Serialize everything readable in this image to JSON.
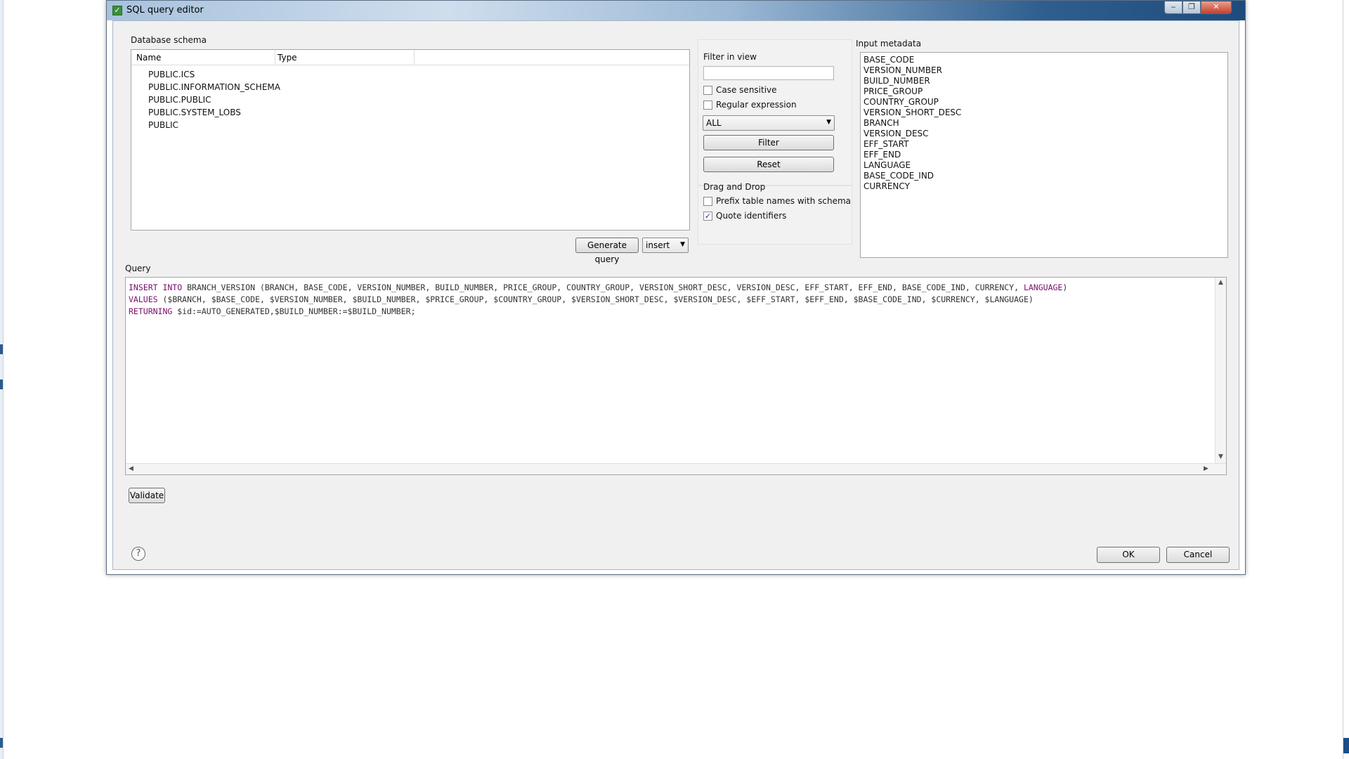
{
  "window": {
    "title": "SQL query editor",
    "minimize": "‒",
    "maximize": "❐",
    "close": "✕"
  },
  "schema": {
    "label": "Database schema",
    "columns": [
      "Name",
      "Type"
    ],
    "items": [
      "PUBLIC.ICS",
      "PUBLIC.INFORMATION_SCHEMA",
      "PUBLIC.PUBLIC",
      "PUBLIC.SYSTEM_LOBS",
      "PUBLIC"
    ]
  },
  "generate": {
    "button": "Generate query",
    "mode": "insert"
  },
  "filter": {
    "label": "Filter in view",
    "value": "",
    "case_sensitive": {
      "label": "Case sensitive",
      "checked": false
    },
    "regex": {
      "label": "Regular expression",
      "checked": false
    },
    "scope": "ALL",
    "filter_button": "Filter",
    "reset_button": "Reset"
  },
  "dnd": {
    "label": "Drag and Drop",
    "prefix": {
      "label": "Prefix table names with schema",
      "checked": false
    },
    "quote": {
      "label": "Quote identifiers",
      "checked": true
    }
  },
  "metadata": {
    "label": "Input metadata",
    "items": [
      "BASE_CODE",
      "VERSION_NUMBER",
      "BUILD_NUMBER",
      "PRICE_GROUP",
      "COUNTRY_GROUP",
      "VERSION_SHORT_DESC",
      "BRANCH",
      "VERSION_DESC",
      "EFF_START",
      "EFF_END",
      "LANGUAGE",
      "BASE_CODE_IND",
      "CURRENCY"
    ]
  },
  "query": {
    "label": "Query",
    "lines": [
      {
        "kw": "INSERT INTO",
        "rest": " BRANCH_VERSION (BRANCH, BASE_CODE, VERSION_NUMBER, BUILD_NUMBER, PRICE_GROUP, COUNTRY_GROUP, VERSION_SHORT_DESC, VERSION_DESC, EFF_START, EFF_END, BASE_CODE_IND, CURRENCY, ",
        "kw2": "LANGUAGE",
        "tail": ")"
      },
      {
        "kw": "VALUES",
        "rest": " ($BRANCH, $BASE_CODE, $VERSION_NUMBER, $BUILD_NUMBER, $PRICE_GROUP, $COUNTRY_GROUP, $VERSION_SHORT_DESC, $VERSION_DESC, $EFF_START, $EFF_END, $BASE_CODE_IND, $CURRENCY, $LANGUAGE)",
        "kw2": "",
        "tail": ""
      },
      {
        "kw": "RETURNING",
        "rest": " $id:=AUTO_GENERATED,$BUILD_NUMBER:=$BUILD_NUMBER;",
        "kw2": "",
        "tail": ""
      }
    ]
  },
  "buttons": {
    "validate": "Validate",
    "ok": "OK",
    "cancel": "Cancel"
  },
  "help": "?",
  "glyphs": {
    "check": "✓",
    "dropdown": "▼",
    "up": "▲",
    "down": "▼",
    "left": "◀",
    "right": "▶"
  }
}
